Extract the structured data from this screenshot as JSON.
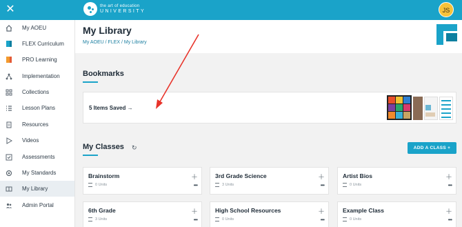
{
  "topbar": {
    "close_icon": "close-icon",
    "logo_line1": "the art of education",
    "logo_line2": "UNIVERSITY",
    "user_initials": "JS"
  },
  "sidebar": {
    "items": [
      {
        "label": "My AOEU",
        "icon": "home-icon"
      },
      {
        "label": "FLEX Curriculum",
        "icon": "flex-icon"
      },
      {
        "label": "PRO Learning",
        "icon": "pro-icon"
      },
      {
        "label": "Implementation",
        "icon": "hierarchy-icon"
      },
      {
        "label": "Collections",
        "icon": "grid-icon"
      },
      {
        "label": "Lesson Plans",
        "icon": "list-icon"
      },
      {
        "label": "Resources",
        "icon": "document-icon"
      },
      {
        "label": "Videos",
        "icon": "play-icon"
      },
      {
        "label": "Assessments",
        "icon": "checkbox-icon"
      },
      {
        "label": "My Standards",
        "icon": "gear-icon"
      },
      {
        "label": "My Library",
        "icon": "book-icon",
        "active": true
      },
      {
        "label": "Admin Portal",
        "icon": "users-icon"
      }
    ]
  },
  "header": {
    "title": "My Library",
    "breadcrumb": "My AOEU / FLEX / My Library"
  },
  "bookmarks": {
    "title": "Bookmarks",
    "saved_link": "5 Items Saved →"
  },
  "classes": {
    "title": "My Classes",
    "add_button": "ADD A CLASS  +",
    "cards": [
      {
        "title": "Brainstorm",
        "units": "0 Units"
      },
      {
        "title": "3rd Grade Science",
        "units": "3 Units"
      },
      {
        "title": "Artist Bios",
        "units": "0 Units"
      },
      {
        "title": "6th Grade",
        "units": "3 Units"
      },
      {
        "title": "High School Resources",
        "units": "0 Units"
      },
      {
        "title": "Example Class",
        "units": "0 Units"
      }
    ]
  },
  "colors": {
    "accent": "#1aa3c9",
    "annotation_arrow": "#e8332a"
  }
}
